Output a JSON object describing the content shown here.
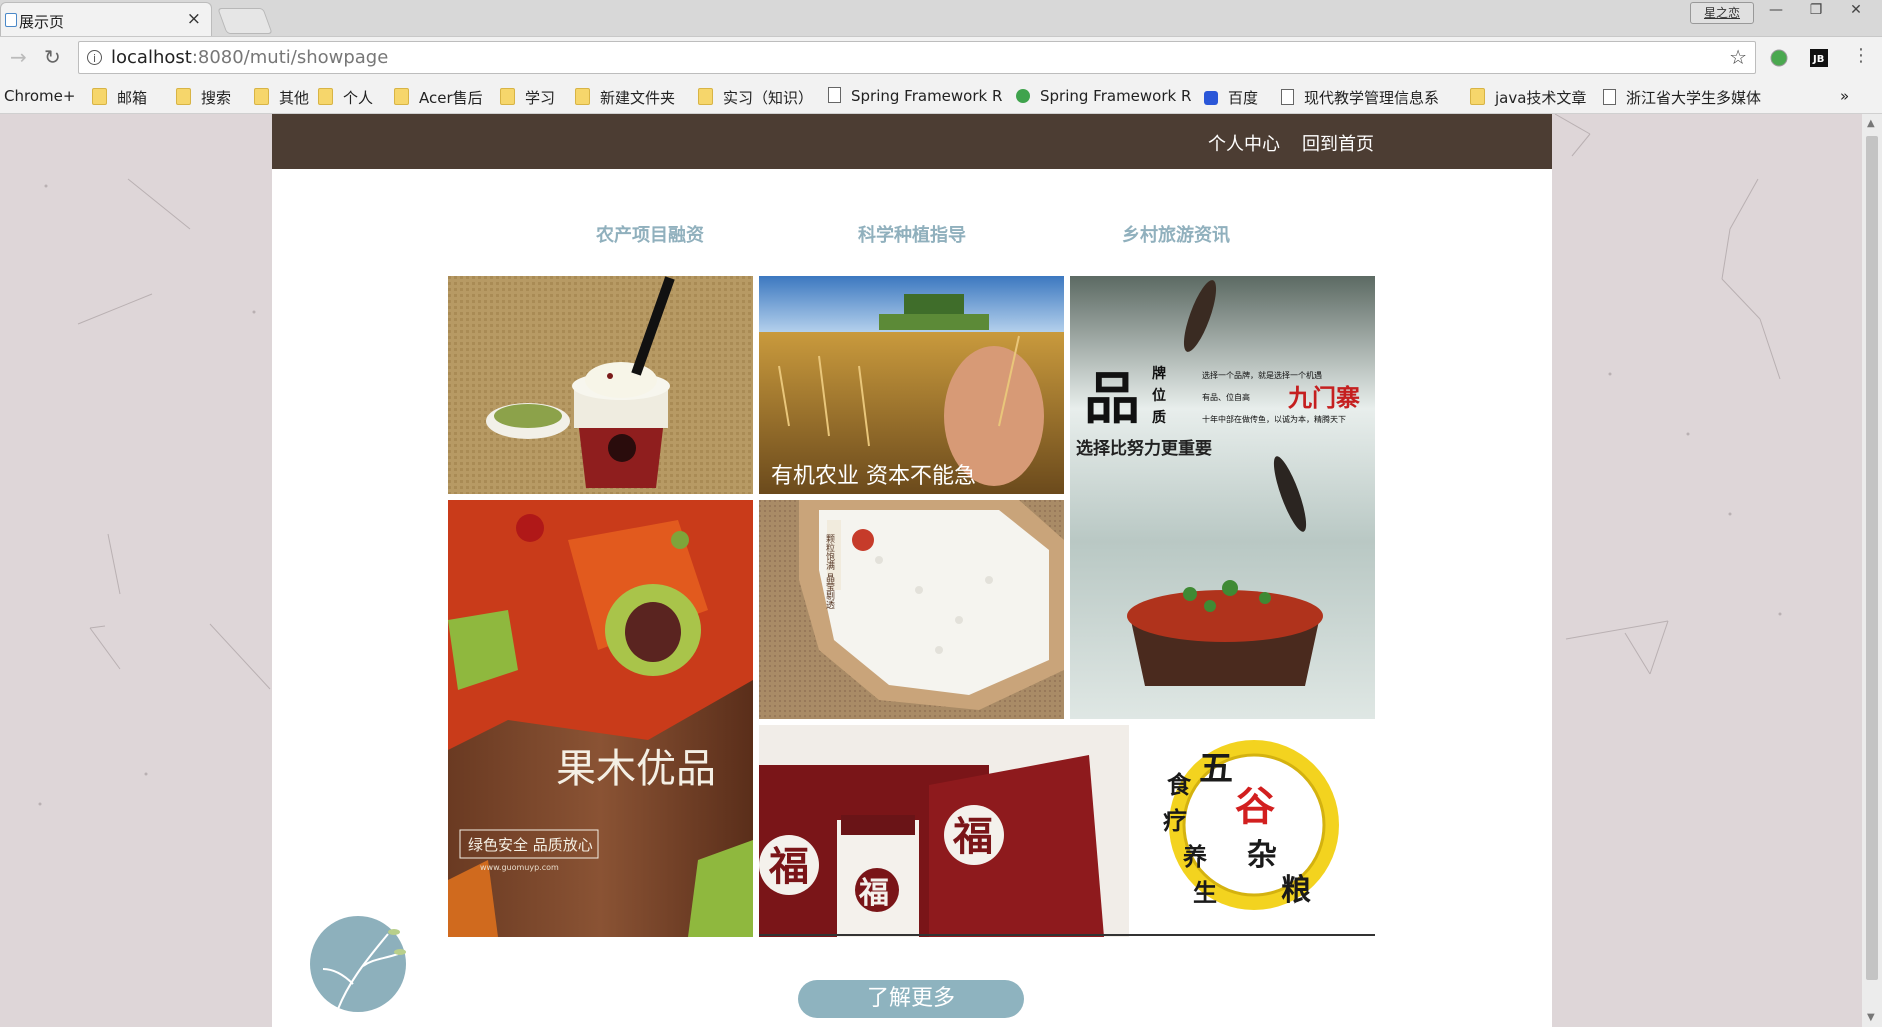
{
  "browser": {
    "tab_title": "展示页",
    "tab_close": "×",
    "profile": "星之恋",
    "window_controls": [
      "—",
      "❐",
      "✕"
    ],
    "url_host": "localhost",
    "url_path": ":8080/muti/showpage",
    "bookmarks_overflow": "»",
    "bookmarks": [
      {
        "label": "Chrome+",
        "icon": "none"
      },
      {
        "label": "邮箱",
        "icon": "folder"
      },
      {
        "label": "搜索",
        "icon": "folder"
      },
      {
        "label": "其他",
        "icon": "folder"
      },
      {
        "label": "个人",
        "icon": "folder"
      },
      {
        "label": "Acer售后",
        "icon": "folder"
      },
      {
        "label": "学习",
        "icon": "folder"
      },
      {
        "label": "新建文件夹",
        "icon": "folder"
      },
      {
        "label": "实习（知识）",
        "icon": "folder"
      },
      {
        "label": "Spring Framework R",
        "icon": "page"
      },
      {
        "label": "Spring Framework R",
        "icon": "green"
      },
      {
        "label": "百度",
        "icon": "blue"
      },
      {
        "label": "现代教学管理信息系",
        "icon": "page"
      },
      {
        "label": "java技术文章",
        "icon": "folder"
      },
      {
        "label": "浙江省大学生多媒体",
        "icon": "page"
      }
    ]
  },
  "header": {
    "personal_center": "个人中心",
    "home": "回到首页"
  },
  "categories": [
    "农产项目融资",
    "科学种植指导",
    "乡村旅游资讯"
  ],
  "tiles": {
    "organic": "有机农业 资本不能急",
    "brand_big": "品",
    "brand_side": "牌\n位\n质",
    "brand_lines": [
      "选择一个品牌，就是选择一个机遇",
      "有品、位自高",
      "十年中部在做传鱼，以诚为本，精腾天下"
    ],
    "brand_name": "九门寨",
    "brand_slogan": "选择比努力更重要",
    "fruit_title": "果木优品",
    "fruit_sub": "绿色安全 品质放心",
    "fruit_url": "www.guomuyp.com",
    "rice_label": "颗粒饱满 晶莹剔透",
    "grain_seal": [
      "五",
      "谷",
      "杂",
      "粮",
      "食",
      "疗",
      "养",
      "生"
    ],
    "fu": "福"
  },
  "more_button": "了解更多",
  "colors": {
    "topbar": "#4c3d33",
    "accent": "#8eb3bf",
    "category_text": "#90b0bd",
    "page_bg": "#ded6d8"
  }
}
